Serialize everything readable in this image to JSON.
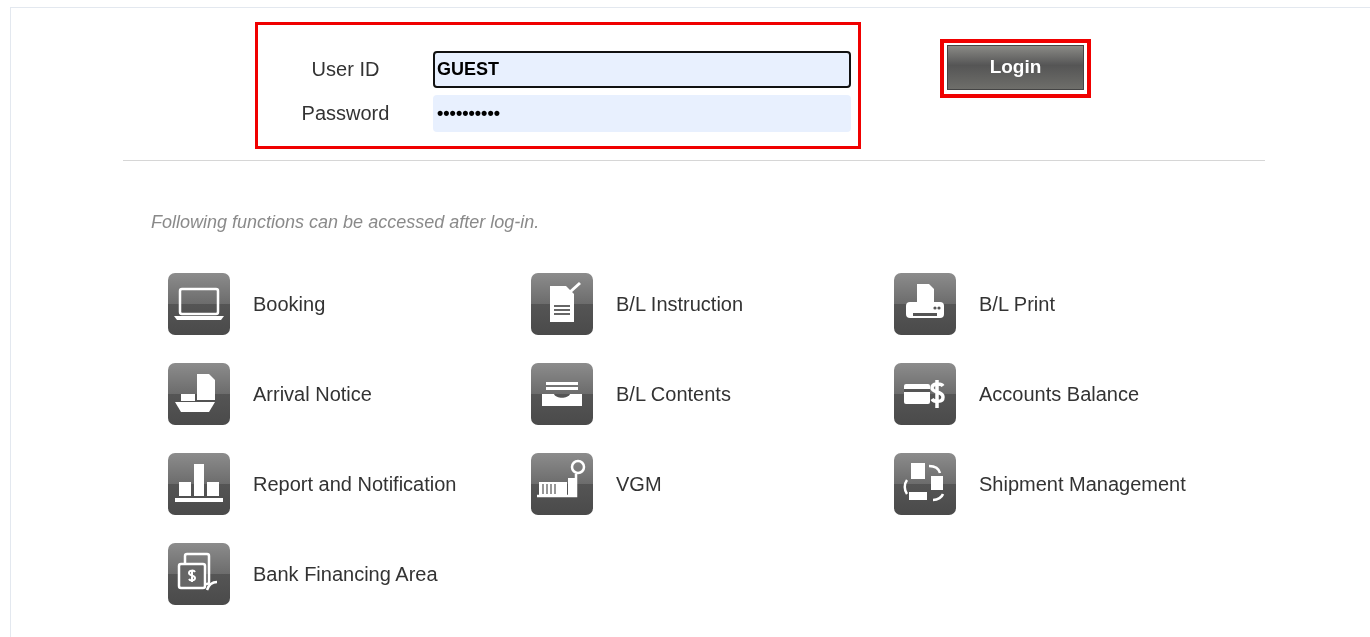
{
  "login_form": {
    "highlighted": true,
    "fields": [
      {
        "label": "User ID",
        "value": "GUEST",
        "focused": true
      },
      {
        "label": "Password",
        "value": "••••••••••",
        "focused": false
      }
    ]
  },
  "login_button": {
    "label": "Login",
    "highlighted": true
  },
  "note": "Following functions can be accessed after log-in.",
  "functions": [
    {
      "label": "Booking"
    },
    {
      "label": "B/L Instruction"
    },
    {
      "label": "B/L Print"
    },
    {
      "label": "Arrival Notice"
    },
    {
      "label": "B/L Contents"
    },
    {
      "label": "Accounts Balance"
    },
    {
      "label": "Report and Notification"
    },
    {
      "label": "VGM"
    },
    {
      "label": "Shipment Management"
    },
    {
      "label": "Bank Financing Area"
    }
  ]
}
